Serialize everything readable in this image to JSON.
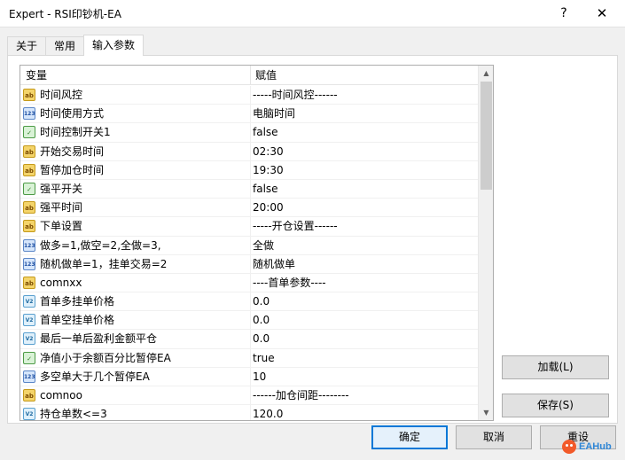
{
  "window": {
    "title": "Expert - RSI印钞机-EA",
    "help_label": "?",
    "close_label": "✕"
  },
  "tabs": [
    {
      "label": "关于",
      "active": false
    },
    {
      "label": "常用",
      "active": false
    },
    {
      "label": "输入参数",
      "active": true
    }
  ],
  "grid": {
    "columns": {
      "variable": "变量",
      "value": "赋值"
    },
    "rows": [
      {
        "type": "ab",
        "name": "时间风控",
        "value": "-----时间风控------"
      },
      {
        "type": "123",
        "name": "时间使用方式",
        "value": "电脑时间"
      },
      {
        "type": "bool",
        "name": "时间控制开关1",
        "value": "false"
      },
      {
        "type": "ab",
        "name": "开始交易时间",
        "value": "02:30"
      },
      {
        "type": "ab",
        "name": "暂停加仓时间",
        "value": "19:30"
      },
      {
        "type": "bool",
        "name": "强平开关",
        "value": "false"
      },
      {
        "type": "ab",
        "name": "强平时间",
        "value": "20:00"
      },
      {
        "type": "ab",
        "name": "下单设置",
        "value": "-----开仓设置------"
      },
      {
        "type": "123",
        "name": "做多=1,做空=2,全做=3,",
        "value": "全做"
      },
      {
        "type": "123",
        "name": "随机做单=1，挂单交易=2",
        "value": "随机做单"
      },
      {
        "type": "ab",
        "name": "comnxx",
        "value": "----首单参数----"
      },
      {
        "type": "v2",
        "name": "首单多挂单价格",
        "value": "0.0"
      },
      {
        "type": "v2",
        "name": "首单空挂单价格",
        "value": "0.0"
      },
      {
        "type": "v2",
        "name": "最后一单后盈利金额平仓",
        "value": "0.0"
      },
      {
        "type": "bool",
        "name": "净值小于余额百分比暂停EA",
        "value": "true"
      },
      {
        "type": "123",
        "name": "多空单大于几个暂停EA",
        "value": "10"
      },
      {
        "type": "ab",
        "name": "comnoo",
        "value": "------加仓间距--------"
      },
      {
        "type": "v2",
        "name": "持仓单数<=3",
        "value": "120.0"
      }
    ]
  },
  "icon_labels": {
    "ab": "ab",
    "123": "123",
    "bool": "✓",
    "v2": "V2"
  },
  "buttons": {
    "load": "加载(L)",
    "save": "保存(S)",
    "ok": "确定",
    "cancel": "取消",
    "reset": "重设"
  },
  "scrollbar": {
    "up": "▲",
    "down": "▼"
  },
  "watermark": {
    "text": "EAHub",
    "color": "#2f86d6",
    "logo_color": "#f25a2a"
  }
}
